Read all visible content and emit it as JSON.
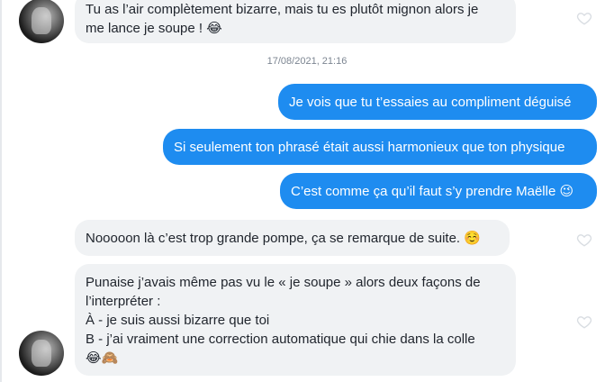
{
  "conversation": {
    "messages": [
      {
        "lines": [
          "Tu as l’air complètement bizarre, mais tu es plutôt mignon alors je",
          "me lance je soupe ! 😂"
        ]
      },
      {
        "timestamp": "17/08/2021, 21:16"
      },
      {
        "text": "Je vois que tu t’essaies au compliment déguisé"
      },
      {
        "text": "Si seulement ton phrasé était aussi harmonieux que ton physique"
      },
      {
        "text": "C’est comme ça qu’il faut s’y prendre Maëlle 😉"
      },
      {
        "text": "Nooooon là c’est trop grande pompe, ça se remarque de suite. ☺️"
      },
      {
        "lines": [
          "Punaise j’avais même pas vu le « je soupe » alors deux façons de",
          "l’interpréter :",
          "À - je suis aussi bizarre que toi",
          "B - j’ai vraiment une correction automatique qui chie dans la colle",
          "😂🙈"
        ]
      }
    ]
  },
  "colors": {
    "sent_bubble": "#1e8cf0",
    "received_bubble": "#f0f2f4",
    "heart_outline": "#d9dde2"
  },
  "icons": {
    "like": "heart-outline-icon",
    "avatar": "profile-photo"
  }
}
